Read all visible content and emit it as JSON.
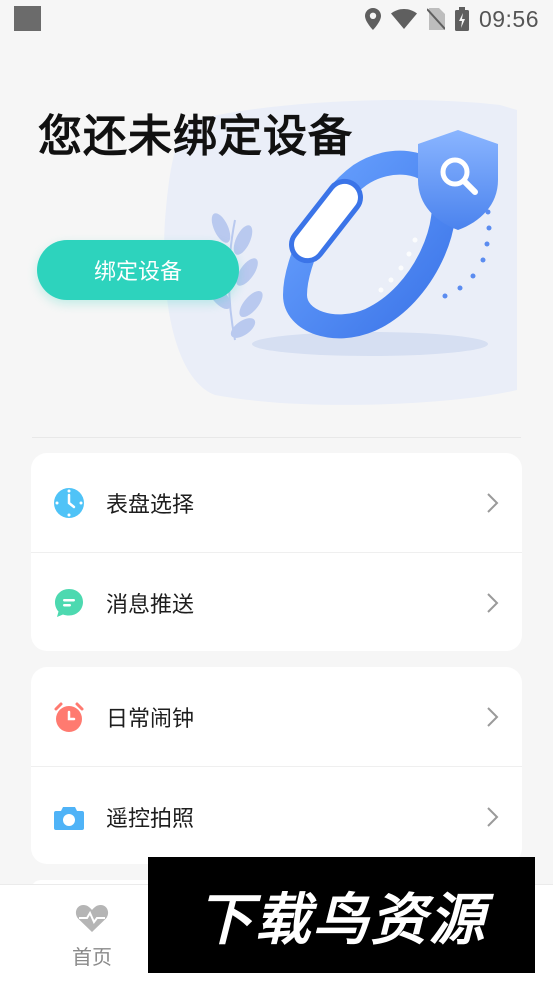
{
  "status_bar": {
    "time": "09:56"
  },
  "hero": {
    "title": "您还未绑定设备",
    "bind_button_label": "绑定设备"
  },
  "menu_groups": [
    {
      "items": [
        {
          "label": "表盘选择",
          "icon": "watch-face-icon",
          "color": "#4fc3f7"
        },
        {
          "label": "消息推送",
          "icon": "message-icon",
          "color": "#4dd9b0"
        }
      ]
    },
    {
      "items": [
        {
          "label": "日常闹钟",
          "icon": "alarm-clock-icon",
          "color": "#ff7a70"
        },
        {
          "label": "遥控拍照",
          "icon": "camera-icon",
          "color": "#4fb3f7"
        }
      ]
    }
  ],
  "tab_bar": {
    "home_label": "首页"
  },
  "watermark": {
    "text": "下载鸟资源"
  },
  "colors": {
    "accent": "#2dd3bd",
    "background": "#f6f6f6",
    "card": "#ffffff"
  }
}
